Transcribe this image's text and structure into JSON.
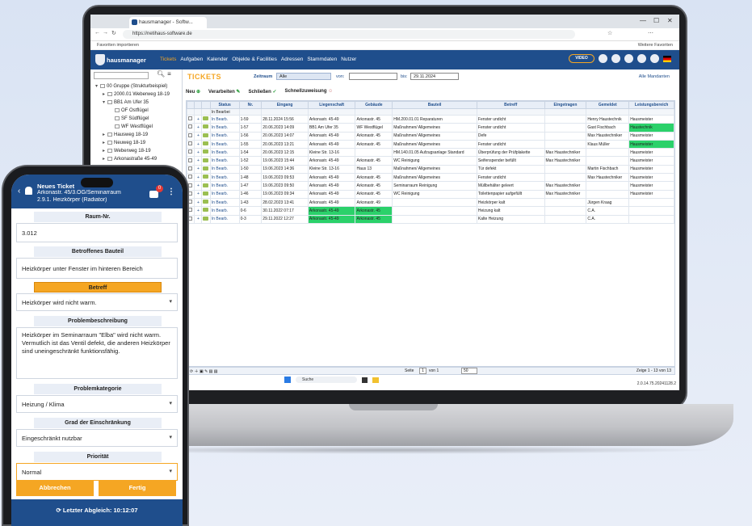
{
  "browser": {
    "tab_title": "hausmanager - Softw...",
    "url": "https://netihaus-software.de",
    "favorites_left": "Favoriten importieren",
    "favorites_right": "Weitere Favoriten"
  },
  "app": {
    "logo": "hausmanager",
    "menu": [
      "Tickets",
      "Aufgaben",
      "Kalender",
      "Objekte & Facilities",
      "Adressen",
      "Stammdaten",
      "Nutzer"
    ],
    "video_label": "VIDEO"
  },
  "tree": {
    "items": [
      {
        "toggle": "▾",
        "label": "00 Gruppe (Strukturbeispiel)",
        "indent": 0
      },
      {
        "toggle": "▸",
        "label": "2000.01 Weberweg 18-19",
        "indent": 1
      },
      {
        "toggle": "▾",
        "label": "BB1 Am Ufer 35",
        "indent": 1
      },
      {
        "toggle": "",
        "label": "OF Ostflügel",
        "indent": 2
      },
      {
        "toggle": "",
        "label": "SF Südflügel",
        "indent": 2
      },
      {
        "toggle": "",
        "label": "WF Westflügel",
        "indent": 2
      },
      {
        "toggle": "▸",
        "label": "Hausweg 18-19",
        "indent": 1
      },
      {
        "toggle": "▸",
        "label": "Neuweg 18-19",
        "indent": 1
      },
      {
        "toggle": "▸",
        "label": "Weberweg 18-19",
        "indent": 1
      },
      {
        "toggle": "▸",
        "label": "Arkonastraße 45-49",
        "indent": 1
      }
    ]
  },
  "tickets": {
    "title": "TICKETS",
    "zeitraum_label": "Zeitraum",
    "zeitraum_value": "Alle",
    "von_label": "von:",
    "bis_label": "bis:",
    "bis_value": "29.11.2024",
    "mandant": "Alle Mandanten",
    "actions": [
      "Neu",
      "Verarbeiten",
      "Schließen",
      "Schnellzuweisung"
    ],
    "columns": [
      "Status",
      "Nr.",
      "Eingang",
      "Liegenschaft",
      "Gebäude",
      "Bauteil",
      "Betreff",
      "Eingetragen",
      "Gemeldet",
      "Leistungsbereich"
    ],
    "status_filter": "In Bearbei",
    "rows": [
      [
        "In Bearb.",
        "1-59",
        "28.11.2024 15:56",
        "Arkonastr. 45-49",
        "Arkonastr. 45",
        "HM.200.01.01 Reparaturen",
        "Fenster undicht",
        "",
        "Henry Haustechnik",
        "Hausmeister"
      ],
      [
        "In Bearb.",
        "1-57",
        "20.06.2023 14:09",
        "BB1 Am Ufer 35",
        "WF Westflügel",
        "Maßnahmen/ Allgemeines",
        "Fenster undicht",
        "",
        "Gast Fischbach",
        "Haustechnik"
      ],
      [
        "In Bearb.",
        "1-56",
        "20.06.2023 14:07",
        "Arkonastr. 45-49",
        "Arkonastr. 45",
        "Maßnahmen/ Allgemeines",
        "Defe",
        "",
        "Max Haustechniker",
        "Hausmeister"
      ],
      [
        "In Bearb.",
        "1-55",
        "20.06.2023 13:21",
        "Arkonastr. 45-49",
        "Arkonastr. 45",
        "Maßnahmen/ Allgemeines",
        "Fenster undicht",
        "",
        "Klaus Müller",
        "Hausmeister"
      ],
      [
        "In Bearb.",
        "1-54",
        "20.06.2023 12:15",
        "Kleine Str. 13-16",
        "",
        "HM.140.01.05 Aufzugsanlage Standard",
        "Überprüfung der Prüfplakette",
        "Max Haustechniker",
        "",
        "Hausmeister"
      ],
      [
        "In Bearb.",
        "1-52",
        "19.06.2023 15:44",
        "Arkonastr. 45-49",
        "Arkonastr. 45",
        "WC Reinigung",
        "Seifenspender befüllt",
        "Max Haustechniker",
        "",
        "Hausmeister"
      ],
      [
        "In Bearb.",
        "1-50",
        "19.06.2023 14:36",
        "Kleine Str. 13-16",
        "Haus 13",
        "Maßnahmen/ Allgemeines",
        "Tür defekt",
        "",
        "Martin Fischbach",
        "Hausmeister"
      ],
      [
        "In Bearb.",
        "1-48",
        "19.06.2023 09:53",
        "Arkonastr. 45-49",
        "Arkonastr. 45",
        "Maßnahmen/ Allgemeines",
        "Fenster undicht",
        "",
        "Max Haustechniker",
        "Hausmeister"
      ],
      [
        "In Bearb.",
        "1-47",
        "19.06.2023 09:50",
        "Arkonastr. 45-49",
        "Arkonastr. 45",
        "Seminarraum Reinigung",
        "Müllbehälter geleert",
        "Max Haustechniker",
        "",
        "Hausmeister"
      ],
      [
        "In Bearb.",
        "1-46",
        "19.06.2023 09:34",
        "Arkonastr. 45-49",
        "Arkonastr. 45",
        "WC Reinigung",
        "Toilettenpapier aufgefüllt",
        "Max Haustechniker",
        "",
        "Hausmeister"
      ],
      [
        "In Bearb.",
        "1-43",
        "28.02.2023 13:41",
        "Arkonastr. 45-49",
        "Arkonastr. 49",
        "",
        "Heizkörper kalt",
        "",
        "Jürgen Kraag",
        ""
      ],
      [
        "In Bearb.",
        "0-6",
        "30.11.2022 07:17",
        "Arkonastr. 45-49",
        "Arkonastr. 45",
        "",
        "Heizung kalt",
        "",
        "C.A.",
        ""
      ],
      [
        "In Bearb.",
        "0-3",
        "29.11.2022 12:27",
        "Arkonastr. 45-49",
        "Arkonastr. 45",
        "",
        "Kalte Heizung",
        "",
        "C.A.",
        ""
      ]
    ],
    "pager_page_label": "Seite",
    "pager_page": "1",
    "pager_of": "von 1",
    "pager_size": "50",
    "pager_info": "Zeige 1 - 13 von 13",
    "version": "2.0.14.75.20241128.2",
    "taskbar_search": "Suche"
  },
  "phone": {
    "header_title": "Neues Ticket",
    "header_line2": "Arkonastr. 45/3.OG/Seminarraum",
    "header_line3": "2.9.1. Heizkörper (Radiator)",
    "badge": "0",
    "fields": [
      {
        "label": "Raum-Nr.",
        "value": "3.012",
        "type": "text"
      },
      {
        "label": "Betroffenes Bauteil",
        "value": "Heizkörper unter Fenster im hinteren Bereich",
        "type": "text"
      },
      {
        "label": "Betreff",
        "value": "Heizkörper wird nicht warm.",
        "type": "select"
      },
      {
        "label": "Problembeschreibung",
        "value": "Heizkörper im Seminarraum \"Elba\" wird nicht warm. Vermutlich ist das Ventil defekt, die anderen Heizkörper sind uneingeschränkt funktionsfähig.",
        "type": "textarea"
      },
      {
        "label": "Problemkategorie",
        "value": "Heizung / Klima",
        "type": "select"
      },
      {
        "label": "Grad der Einschränkung",
        "value": "Eingeschränkt nutzbar",
        "type": "select"
      },
      {
        "label": "Priorität",
        "value": "Normal",
        "type": "select"
      }
    ],
    "cancel": "Abbrechen",
    "done": "Fertig",
    "sync": "Letzter Abgleich: 10:12:07"
  },
  "colors": {
    "brand": "#1f4e8c",
    "accent": "#f5a623",
    "highlight": "#2bd16a"
  }
}
